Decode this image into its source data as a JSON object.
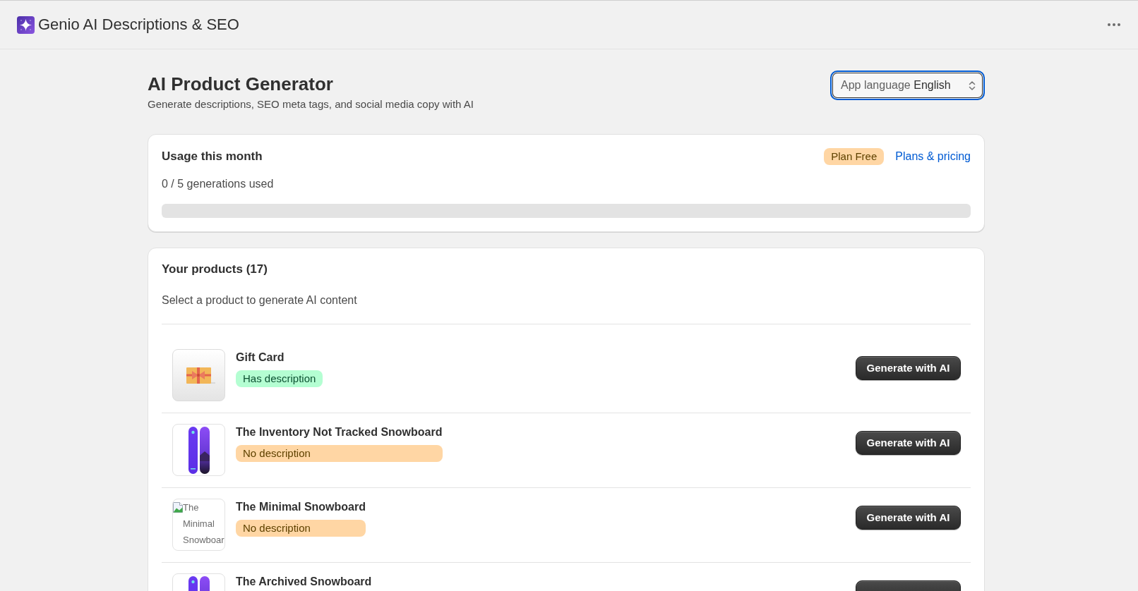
{
  "app_bar": {
    "title": "Genio AI Descriptions & SEO"
  },
  "page_header": {
    "title": "AI Product Generator",
    "subtitle": "Generate descriptions, SEO meta tags, and social media copy with AI",
    "language_select": {
      "label": "App language",
      "value": "English",
      "focused": true
    }
  },
  "usage": {
    "title": "Usage this month",
    "plan_badge": "Plan Free",
    "plans_link": "Plans & pricing",
    "summary": "0 / 5 generations used",
    "level": 0
  },
  "products": {
    "title": "Your products (17)",
    "subtitle": "Select a product to generate AI content",
    "items": [
      {
        "name": "Gift Card",
        "image": {
          "kind": "gift_card"
        },
        "status": {
          "label": "Has description",
          "has_description": true
        },
        "button": "Generate with AI"
      },
      {
        "name": "The Inventory Not Tracked Snowboard",
        "image": {
          "kind": "snowboard"
        },
        "status": {
          "label": "No description",
          "has_description": false
        },
        "button": "Generate with AI"
      },
      {
        "name": "The Minimal Snowboard",
        "image": {
          "kind": "missing",
          "alt": "The Minimal Snowboar"
        },
        "status": {
          "label": "No description",
          "has_description": false
        },
        "button": "Generate with AI"
      },
      {
        "name": "The Archived Snowboard",
        "image": {
          "kind": "snowboard"
        }
      }
    ]
  }
}
